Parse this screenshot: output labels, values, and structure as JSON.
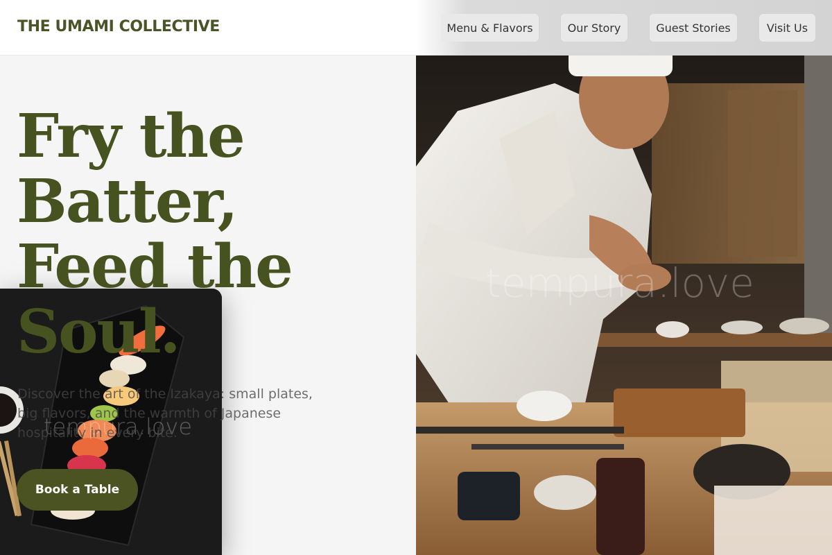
{
  "header": {
    "brand": "THE UMAMI COLLECTIVE",
    "nav": [
      "Menu & Flavors",
      "Our Story",
      "Guest Stories",
      "Visit Us"
    ]
  },
  "hero": {
    "headline_lines": [
      "Fry the",
      "Batter,",
      "Feed the",
      "Soul."
    ],
    "subtext": "Discover the art of the Izakaya: small plates, big flavors, and the warmth of Japanese hospitality in every bite.",
    "cta_label": "Book a Table"
  },
  "images": {
    "chef_watermark": "tempura.love",
    "sushi_watermark": "tempura.love"
  },
  "colors": {
    "brand": "#46521f",
    "cta_bg": "#4c5322",
    "nav_bg": "#e9e9e9",
    "page_bg": "#f5f5f5"
  }
}
